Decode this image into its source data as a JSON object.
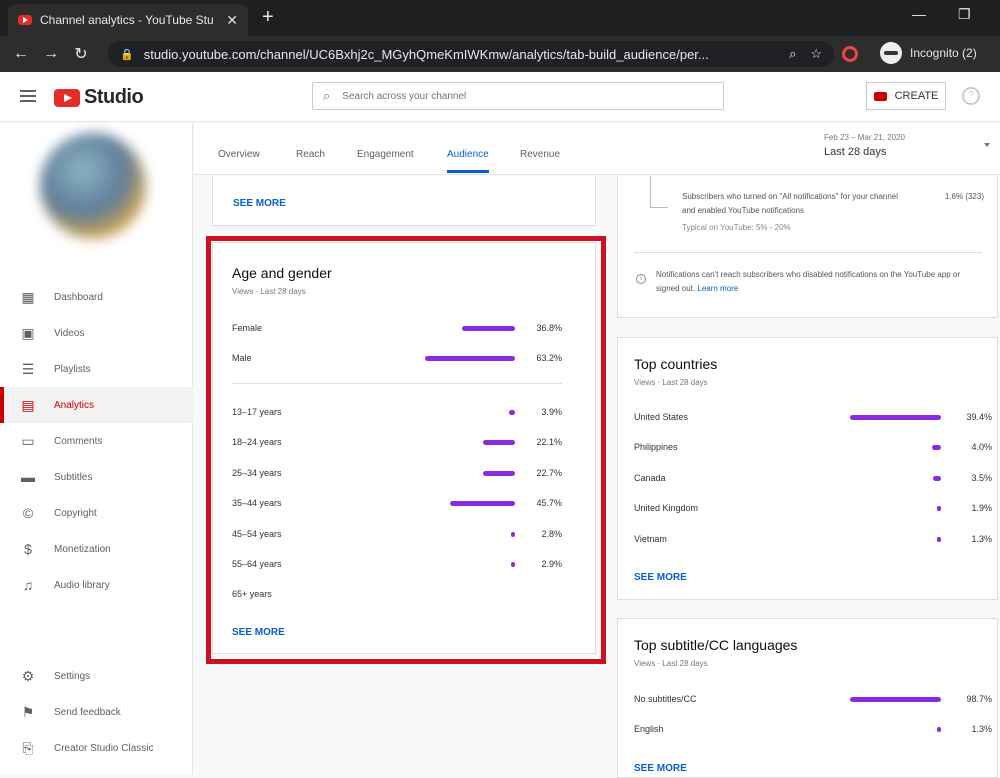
{
  "browser": {
    "tab_title": "Channel analytics - YouTube Stu",
    "url": "studio.youtube.com/channel/UC6Bxhj2c_MGyhQmeKmIWKmw/analytics/tab-build_audience/per...",
    "profile_label": "Incognito (2)"
  },
  "header": {
    "logo_text": "Studio",
    "search_placeholder": "Search across your channel",
    "create_label": "CREATE"
  },
  "sidebar": {
    "items": [
      {
        "label": "Dashboard",
        "icon": "dashboard-icon"
      },
      {
        "label": "Videos",
        "icon": "videos-icon"
      },
      {
        "label": "Playlists",
        "icon": "playlists-icon"
      },
      {
        "label": "Analytics",
        "icon": "analytics-icon",
        "active": true
      },
      {
        "label": "Comments",
        "icon": "comments-icon"
      },
      {
        "label": "Subtitles",
        "icon": "subtitles-icon"
      },
      {
        "label": "Copyright",
        "icon": "copyright-icon"
      },
      {
        "label": "Monetization",
        "icon": "monetization-icon"
      },
      {
        "label": "Audio library",
        "icon": "audio-library-icon"
      },
      {
        "label": "Settings",
        "icon": "settings-icon"
      },
      {
        "label": "Send feedback",
        "icon": "feedback-icon"
      },
      {
        "label": "Creator Studio Classic",
        "icon": "classic-icon"
      }
    ]
  },
  "tabs": {
    "overview": "Overview",
    "reach": "Reach",
    "engagement": "Engagement",
    "audience": "Audience",
    "revenue": "Revenue",
    "active": "Audience"
  },
  "date_range": {
    "dates": "Feb 23 – Mar 21, 2020",
    "label": "Last 28 days"
  },
  "top_left_card": {
    "see_more": "SEE MORE"
  },
  "notifications_card": {
    "text": "Subscribers who turned on \"All notifications\" for your channel and enabled YouTube notifications",
    "typical": "Typical on YouTube: 5% - 20%",
    "value": "1.6% (323)",
    "info": "Notifications can't reach subscribers who disabled notifications on the YouTube app or signed out.",
    "learn_more": "Learn more"
  },
  "age_gender": {
    "title": "Age and gender",
    "subtitle": "Views · Last 28 days",
    "gender": [
      {
        "label": "Female",
        "value": "36.8%",
        "pct": 36.8
      },
      {
        "label": "Male",
        "value": "63.2%",
        "pct": 63.2
      }
    ],
    "ages": [
      {
        "label": "13–17 years",
        "value": "3.9%",
        "pct": 3.9
      },
      {
        "label": "18–24 years",
        "value": "22.1%",
        "pct": 22.1
      },
      {
        "label": "25–34 years",
        "value": "22.7%",
        "pct": 22.7
      },
      {
        "label": "35–44 years",
        "value": "45.7%",
        "pct": 45.7
      },
      {
        "label": "45–54 years",
        "value": "2.8%",
        "pct": 2.8
      },
      {
        "label": "55–64 years",
        "value": "2.9%",
        "pct": 2.9
      },
      {
        "label": "65+ years",
        "value": "",
        "pct": 0
      }
    ],
    "see_more": "SEE MORE"
  },
  "top_countries": {
    "title": "Top countries",
    "subtitle": "Views · Last 28 days",
    "rows": [
      {
        "label": "United States",
        "value": "39.4%",
        "pct": 39.4
      },
      {
        "label": "Philippines",
        "value": "4.0%",
        "pct": 4.0
      },
      {
        "label": "Canada",
        "value": "3.5%",
        "pct": 3.5
      },
      {
        "label": "United Kingdom",
        "value": "1.9%",
        "pct": 1.9
      },
      {
        "label": "Vietnam",
        "value": "1.3%",
        "pct": 1.3
      }
    ],
    "see_more": "SEE MORE"
  },
  "top_languages": {
    "title": "Top subtitle/CC languages",
    "subtitle": "Views · Last 28 days",
    "rows": [
      {
        "label": "No subtitles/CC",
        "value": "98.7%",
        "pct": 98.7
      },
      {
        "label": "English",
        "value": "1.3%",
        "pct": 1.3
      }
    ],
    "see_more": "SEE MORE"
  },
  "colors": {
    "bar": "#8a2be2",
    "accent": "#065fd4",
    "highlight": "#cc1122",
    "youtube_red": "#e52d27"
  }
}
